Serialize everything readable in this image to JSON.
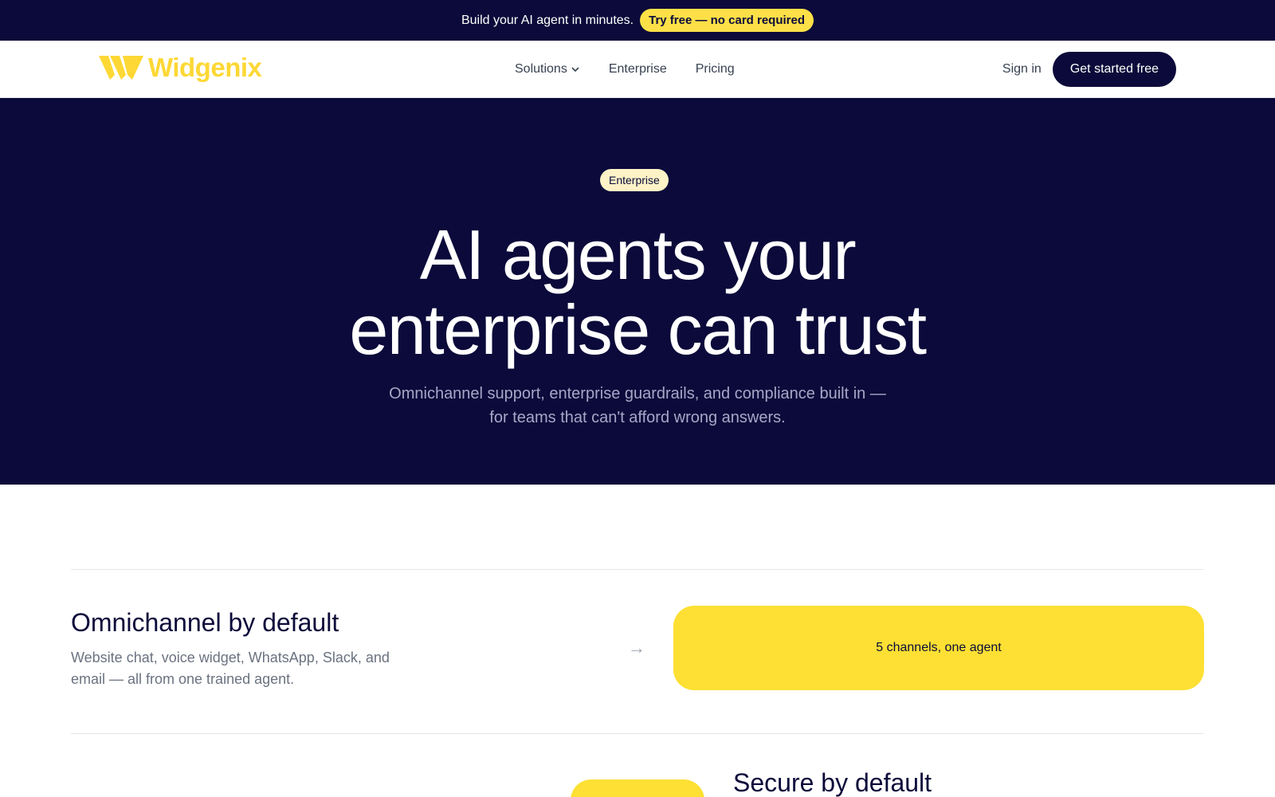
{
  "banner": {
    "text": "Build your AI agent in minutes.",
    "cta": "Try free — no card required"
  },
  "nav": {
    "logo_text": "Widgenix",
    "links": [
      {
        "label": "Solutions",
        "has_dropdown": true
      },
      {
        "label": "Enterprise"
      },
      {
        "label": "Pricing"
      }
    ],
    "sign_in": "Sign in",
    "get_started": "Get started free"
  },
  "hero": {
    "badge": "Enterprise",
    "title_line1": "AI agents your",
    "title_line2": "enterprise can trust",
    "subtitle": "Omnichannel support, enterprise guardrails, and compliance built in — for teams that can't afford wrong answers."
  },
  "features": [
    {
      "title": "Omnichannel by default",
      "description": "Website chat, voice widget, WhatsApp, Slack, and email — all from one trained agent.",
      "arrow": "→",
      "card_label": "5 channels, one agent"
    },
    {
      "title": "Secure by default"
    }
  ],
  "colors": {
    "navy": "#0b0a3a",
    "accent_yellow": "#fde047",
    "badge_bg": "#fef3c7"
  }
}
